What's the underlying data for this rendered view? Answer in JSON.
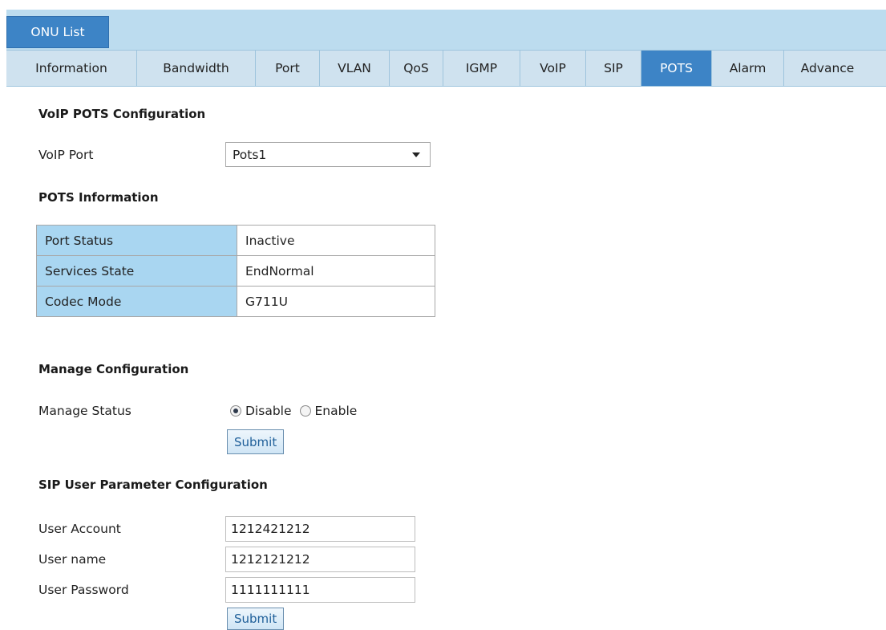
{
  "header": {
    "onu_list_label": "ONU List"
  },
  "tabs": [
    {
      "label": "Information"
    },
    {
      "label": "Bandwidth"
    },
    {
      "label": "Port"
    },
    {
      "label": "VLAN"
    },
    {
      "label": "QoS"
    },
    {
      "label": "IGMP"
    },
    {
      "label": "VoIP"
    },
    {
      "label": "SIP"
    },
    {
      "label": "POTS",
      "active": true
    },
    {
      "label": "Alarm"
    },
    {
      "label": "Advance"
    }
  ],
  "voip_pots": {
    "title": "VoIP POTS Configuration",
    "port_label": "VoIP Port",
    "port_value": "Pots1"
  },
  "pots_info": {
    "title": "POTS Information",
    "rows": [
      {
        "key": "Port Status",
        "value": "Inactive"
      },
      {
        "key": "Services State",
        "value": "EndNormal"
      },
      {
        "key": "Codec Mode",
        "value": "G711U"
      }
    ]
  },
  "manage": {
    "title": "Manage Configuration",
    "status_label": "Manage Status",
    "option_disable": "Disable",
    "option_enable": "Enable",
    "selected": "Disable",
    "submit_label": "Submit"
  },
  "sip_user": {
    "title": "SIP User Parameter Configuration",
    "account_label": "User Account",
    "account_value": "1212421212",
    "name_label": "User name",
    "name_value": "1212121212",
    "password_label": "User Password",
    "password_value": "1111111111",
    "submit_label": "Submit"
  }
}
